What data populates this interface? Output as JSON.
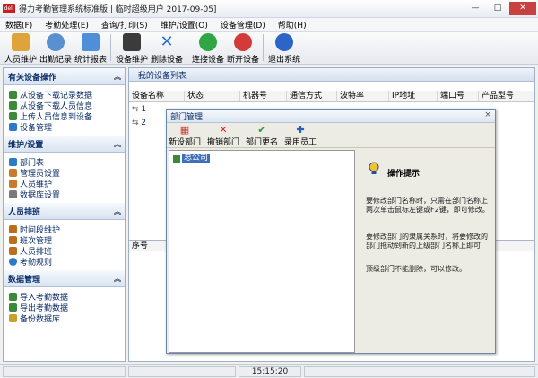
{
  "window": {
    "title": "得力考勤管理系统标准版  |  临时超级用户  2017-09-05]",
    "logo_text": "deli",
    "min_glyph": "—",
    "max_glyph": "□",
    "close_glyph": "✕"
  },
  "menu": [
    "数据(F)",
    "考勤处理(E)",
    "查询/打印(S)",
    "维护/设置(O)",
    "设备管理(D)",
    "帮助(H)"
  ],
  "toolbar": {
    "buttons": [
      {
        "label": "人员维护",
        "icon": "people-icon",
        "color": "#e0a23a"
      },
      {
        "label": "出勤记录",
        "icon": "clock-icon",
        "color": "#5a8fd0"
      },
      {
        "label": "统计报表",
        "icon": "report-icon",
        "color": "#4f8ed8"
      },
      {
        "label": "设备维护",
        "icon": "device-icon",
        "color": "#3b3b3b"
      },
      {
        "label": "删除设备",
        "icon": "delete-x-icon",
        "color": "#2a6fc9"
      },
      {
        "label": "连接设备",
        "icon": "play-icon",
        "color": "#2fa544"
      },
      {
        "label": "断开设备",
        "icon": "stop-icon",
        "color": "#d43a3a"
      },
      {
        "label": "退出系统",
        "icon": "power-icon",
        "color": "#2c64c8"
      }
    ]
  },
  "sidebar": {
    "sections": [
      {
        "title": "有关设备操作",
        "items": [
          {
            "label": "从设备下载记录数据",
            "icon": "download-icon",
            "color": "#3a8a3a"
          },
          {
            "label": "从设备下载人员信息",
            "icon": "download-icon",
            "color": "#3a8a3a"
          },
          {
            "label": "上传人员信息到设备",
            "icon": "upload-icon",
            "color": "#3a8a3a"
          },
          {
            "label": "设备管理",
            "icon": "device-icon",
            "color": "#2c7ac8"
          }
        ]
      },
      {
        "title": "维护/设置",
        "items": [
          {
            "label": "部门表",
            "icon": "department-icon",
            "color": "#2c7ac8"
          },
          {
            "label": "管理员设置",
            "icon": "admin-icon",
            "color": "#c87a2c"
          },
          {
            "label": "人员维护",
            "icon": "person-icon",
            "color": "#c87a2c"
          },
          {
            "label": "数据库设置",
            "icon": "database-icon",
            "color": "#7a7a7a"
          }
        ]
      },
      {
        "title": "人员排班",
        "items": [
          {
            "label": "时间段维护",
            "icon": "timeslot-icon",
            "color": "#b8701f"
          },
          {
            "label": "班次管理",
            "icon": "shift-icon",
            "color": "#b8701f"
          },
          {
            "label": "人员排班",
            "icon": "schedule-icon",
            "color": "#b8701f"
          },
          {
            "label": "考勤规则",
            "icon": "rule-icon",
            "color": "#2c7ac8"
          }
        ]
      },
      {
        "title": "数据管理",
        "items": [
          {
            "label": "导入考勤数据",
            "icon": "import-icon",
            "color": "#3a8a3a"
          },
          {
            "label": "导出考勤数据",
            "icon": "export-icon",
            "color": "#3a8a3a"
          },
          {
            "label": "备份数据库",
            "icon": "backup-icon",
            "color": "#c8a02c"
          }
        ]
      }
    ],
    "chevron": "︽"
  },
  "device_list": {
    "title": "我的设备列表",
    "columns": [
      "设备名称",
      "状态",
      "机器号",
      "通信方式",
      "波特率",
      "IP地址",
      "端口号",
      "产品型号"
    ],
    "rows": [
      "1",
      "2"
    ]
  },
  "records": {
    "columns": [
      "序号",
      "",
      "",
      "",
      ""
    ]
  },
  "status": {
    "time": "15:15:20"
  },
  "dialog": {
    "title": "部门管理",
    "close": "×",
    "tools": [
      {
        "label": "新设部门",
        "icon": "new-dept-icon",
        "glyph": "▦",
        "color": "#c0392b"
      },
      {
        "label": "撤销部门",
        "icon": "cancel-dept-icon",
        "glyph": "✕",
        "color": "#d62c2c"
      },
      {
        "label": "部门更名",
        "icon": "rename-dept-icon",
        "glyph": "✔",
        "color": "#2a9a3a"
      },
      {
        "label": "录用员工",
        "icon": "hire-employee-icon",
        "glyph": "✚",
        "color": "#2a5fc0"
      }
    ],
    "tree_root": "总公司",
    "help": {
      "title": "操作提示",
      "paragraphs": [
        "要修改部门名称时，只需在部门名称上两次单击鼠标左键或F2键，即可修改。",
        "要修改部门的隶属关系时，将要修改的部门拖动到新的上级部门名称上即可",
        "顶级部门不能删除，可以修改。"
      ]
    }
  }
}
